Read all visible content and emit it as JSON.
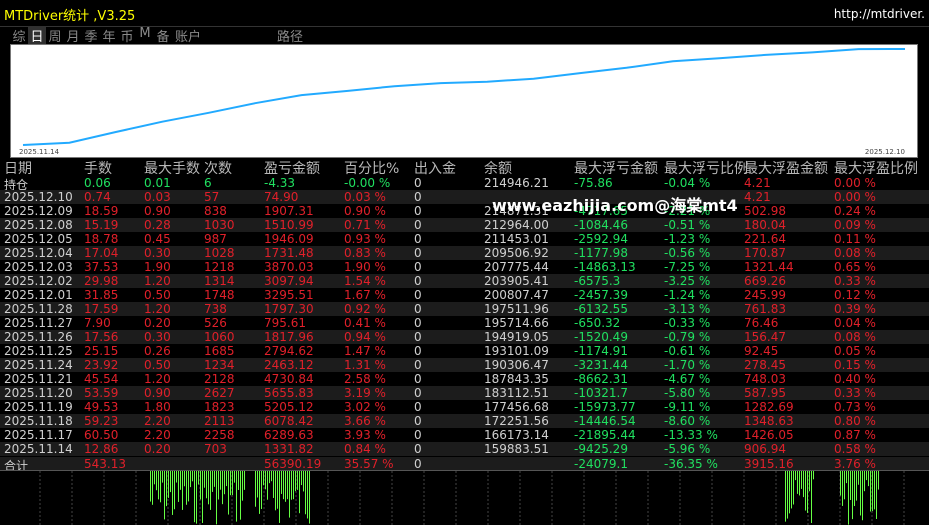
{
  "window": {
    "title": "MTDriver统计 ,V3.25",
    "url": "http://mtdriver."
  },
  "tabs": [
    {
      "label": "综",
      "active": false
    },
    {
      "label": "日",
      "active": true
    },
    {
      "label": "周",
      "active": false
    },
    {
      "label": "月",
      "active": false
    },
    {
      "label": "季",
      "active": false
    },
    {
      "label": "年",
      "active": false
    },
    {
      "label": "币",
      "active": false
    },
    {
      "label": "M",
      "active": false
    },
    {
      "label": "备",
      "active": false
    },
    {
      "label": "账户",
      "active": false
    },
    {
      "label": "路径",
      "active": false
    }
  ],
  "chart": {
    "start_label": "2025.11.14",
    "end_label": "2025.12.10",
    "line_color": "#22aaff"
  },
  "headers": [
    "日期",
    "手数",
    "最大手数",
    "次数",
    "盈亏金额",
    "百分比%",
    "出入金",
    "余额",
    "最大浮亏金额",
    "最大浮亏比例",
    "最大浮盈金额",
    "最大浮盈比例"
  ],
  "holding_row": [
    "持仓",
    "0.06",
    "0.01",
    "6",
    "-4.33",
    "-0.00 %",
    "0",
    "214946.21",
    "-75.86",
    "-0.04 %",
    "4.21",
    "0.00 %"
  ],
  "rows": [
    [
      "2025.12.10",
      "0.74",
      "0.03",
      "57",
      "74.90",
      "0.03 %",
      "0",
      "",
      "",
      "",
      "4.21",
      "0.00 %"
    ],
    [
      "2025.12.09",
      "18.59",
      "0.90",
      "838",
      "1907.31",
      "0.90 %",
      "0",
      "214871.31",
      "-4717.65",
      "-2.21 %",
      "502.98",
      "0.24 %"
    ],
    [
      "2025.12.08",
      "15.19",
      "0.28",
      "1030",
      "1510.99",
      "0.71 %",
      "0",
      "212964.00",
      "-1084.46",
      "-0.51 %",
      "180.04",
      "0.09 %"
    ],
    [
      "2025.12.05",
      "18.78",
      "0.45",
      "987",
      "1946.09",
      "0.93 %",
      "0",
      "211453.01",
      "-2592.94",
      "-1.23 %",
      "221.64",
      "0.11 %"
    ],
    [
      "2025.12.04",
      "17.04",
      "0.30",
      "1028",
      "1731.48",
      "0.83 %",
      "0",
      "209506.92",
      "-1177.98",
      "-0.56 %",
      "170.87",
      "0.08 %"
    ],
    [
      "2025.12.03",
      "37.53",
      "1.90",
      "1218",
      "3870.03",
      "1.90 %",
      "0",
      "207775.44",
      "-14863.13",
      "-7.25 %",
      "1321.44",
      "0.65 %"
    ],
    [
      "2025.12.02",
      "29.98",
      "1.20",
      "1314",
      "3097.94",
      "1.54 %",
      "0",
      "203905.41",
      "-6575.3",
      "-3.25 %",
      "669.26",
      "0.33 %"
    ],
    [
      "2025.12.01",
      "31.85",
      "0.50",
      "1748",
      "3295.51",
      "1.67 %",
      "0",
      "200807.47",
      "-2457.39",
      "-1.24 %",
      "245.99",
      "0.12 %"
    ],
    [
      "2025.11.28",
      "17.59",
      "1.20",
      "738",
      "1797.30",
      "0.92 %",
      "0",
      "197511.96",
      "-6132.55",
      "-3.13 %",
      "761.83",
      "0.39 %"
    ],
    [
      "2025.11.27",
      "7.90",
      "0.20",
      "526",
      "795.61",
      "0.41 %",
      "0",
      "195714.66",
      "-650.32",
      "-0.33 %",
      "76.46",
      "0.04 %"
    ],
    [
      "2025.11.26",
      "17.56",
      "0.30",
      "1060",
      "1817.96",
      "0.94 %",
      "0",
      "194919.05",
      "-1520.49",
      "-0.79 %",
      "156.47",
      "0.08 %"
    ],
    [
      "2025.11.25",
      "25.15",
      "0.26",
      "1685",
      "2794.62",
      "1.47 %",
      "0",
      "193101.09",
      "-1174.91",
      "-0.61 %",
      "92.45",
      "0.05 %"
    ],
    [
      "2025.11.24",
      "23.92",
      "0.50",
      "1234",
      "2463.12",
      "1.31 %",
      "0",
      "190306.47",
      "-3231.44",
      "-1.70 %",
      "278.45",
      "0.15 %"
    ],
    [
      "2025.11.21",
      "45.54",
      "1.20",
      "2128",
      "4730.84",
      "2.58 %",
      "0",
      "187843.35",
      "-8662.31",
      "-4.67 %",
      "748.03",
      "0.40 %"
    ],
    [
      "2025.11.20",
      "53.59",
      "0.90",
      "2627",
      "5655.83",
      "3.19 %",
      "0",
      "183112.51",
      "-10321.7",
      "-5.80 %",
      "587.95",
      "0.33 %"
    ],
    [
      "2025.11.19",
      "49.53",
      "1.80",
      "1823",
      "5205.12",
      "3.02 %",
      "0",
      "177456.68",
      "-15973.77",
      "-9.11 %",
      "1282.69",
      "0.73 %"
    ],
    [
      "2025.11.18",
      "59.23",
      "2.20",
      "2113",
      "6078.42",
      "3.66 %",
      "0",
      "172251.56",
      "-14446.54",
      "-8.60 %",
      "1348.63",
      "0.80 %"
    ],
    [
      "2025.11.17",
      "60.50",
      "2.20",
      "2258",
      "6289.63",
      "3.93 %",
      "0",
      "166173.14",
      "-21895.44",
      "-13.33 %",
      "1426.05",
      "0.87 %"
    ],
    [
      "2025.11.14",
      "12.86",
      "0.20",
      "703",
      "1331.82",
      "0.84 %",
      "0",
      "159883.51",
      "-9425.29",
      "-5.96 %",
      "906.94",
      "0.58 %"
    ]
  ],
  "total_row": [
    "合计",
    "543.13",
    "",
    "",
    "56390.19",
    "35.57 %",
    "0",
    "",
    "-24079.1",
    "-36.35 %",
    "3915.16",
    "3.76 %"
  ],
  "watermark": "www.eazhijia.com@海棠mt4",
  "colors": {
    "positive": "#e0202a",
    "negative": "#20e060",
    "title": "#ffff00",
    "histogram": "#66ff44"
  }
}
